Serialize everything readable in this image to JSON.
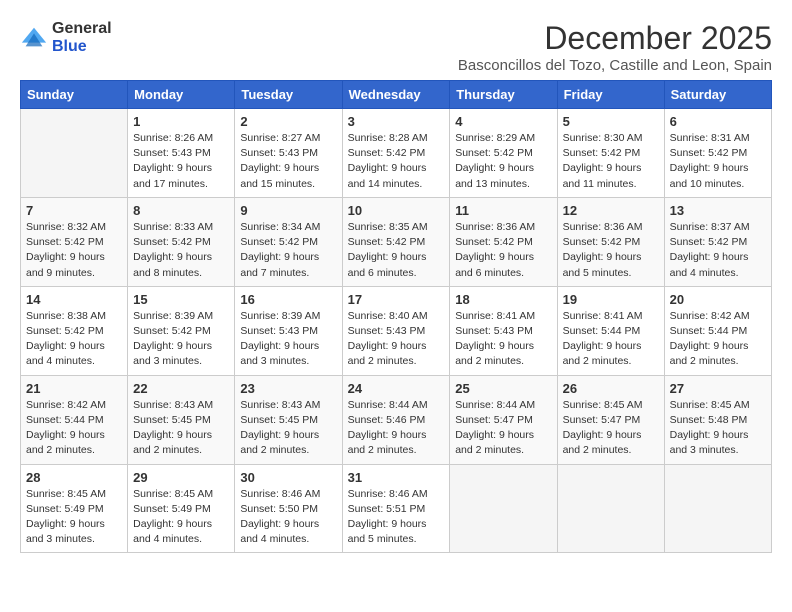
{
  "logo": {
    "general": "General",
    "blue": "Blue"
  },
  "title": "December 2025",
  "location": "Basconcillos del Tozo, Castille and Leon, Spain",
  "days_of_week": [
    "Sunday",
    "Monday",
    "Tuesday",
    "Wednesday",
    "Thursday",
    "Friday",
    "Saturday"
  ],
  "weeks": [
    [
      {
        "day": "",
        "empty": true
      },
      {
        "day": "1",
        "sunrise": "Sunrise: 8:26 AM",
        "sunset": "Sunset: 5:43 PM",
        "daylight": "Daylight: 9 hours and 17 minutes."
      },
      {
        "day": "2",
        "sunrise": "Sunrise: 8:27 AM",
        "sunset": "Sunset: 5:43 PM",
        "daylight": "Daylight: 9 hours and 15 minutes."
      },
      {
        "day": "3",
        "sunrise": "Sunrise: 8:28 AM",
        "sunset": "Sunset: 5:42 PM",
        "daylight": "Daylight: 9 hours and 14 minutes."
      },
      {
        "day": "4",
        "sunrise": "Sunrise: 8:29 AM",
        "sunset": "Sunset: 5:42 PM",
        "daylight": "Daylight: 9 hours and 13 minutes."
      },
      {
        "day": "5",
        "sunrise": "Sunrise: 8:30 AM",
        "sunset": "Sunset: 5:42 PM",
        "daylight": "Daylight: 9 hours and 11 minutes."
      },
      {
        "day": "6",
        "sunrise": "Sunrise: 8:31 AM",
        "sunset": "Sunset: 5:42 PM",
        "daylight": "Daylight: 9 hours and 10 minutes."
      }
    ],
    [
      {
        "day": "7",
        "sunrise": "Sunrise: 8:32 AM",
        "sunset": "Sunset: 5:42 PM",
        "daylight": "Daylight: 9 hours and 9 minutes."
      },
      {
        "day": "8",
        "sunrise": "Sunrise: 8:33 AM",
        "sunset": "Sunset: 5:42 PM",
        "daylight": "Daylight: 9 hours and 8 minutes."
      },
      {
        "day": "9",
        "sunrise": "Sunrise: 8:34 AM",
        "sunset": "Sunset: 5:42 PM",
        "daylight": "Daylight: 9 hours and 7 minutes."
      },
      {
        "day": "10",
        "sunrise": "Sunrise: 8:35 AM",
        "sunset": "Sunset: 5:42 PM",
        "daylight": "Daylight: 9 hours and 6 minutes."
      },
      {
        "day": "11",
        "sunrise": "Sunrise: 8:36 AM",
        "sunset": "Sunset: 5:42 PM",
        "daylight": "Daylight: 9 hours and 6 minutes."
      },
      {
        "day": "12",
        "sunrise": "Sunrise: 8:36 AM",
        "sunset": "Sunset: 5:42 PM",
        "daylight": "Daylight: 9 hours and 5 minutes."
      },
      {
        "day": "13",
        "sunrise": "Sunrise: 8:37 AM",
        "sunset": "Sunset: 5:42 PM",
        "daylight": "Daylight: 9 hours and 4 minutes."
      }
    ],
    [
      {
        "day": "14",
        "sunrise": "Sunrise: 8:38 AM",
        "sunset": "Sunset: 5:42 PM",
        "daylight": "Daylight: 9 hours and 4 minutes."
      },
      {
        "day": "15",
        "sunrise": "Sunrise: 8:39 AM",
        "sunset": "Sunset: 5:42 PM",
        "daylight": "Daylight: 9 hours and 3 minutes."
      },
      {
        "day": "16",
        "sunrise": "Sunrise: 8:39 AM",
        "sunset": "Sunset: 5:43 PM",
        "daylight": "Daylight: 9 hours and 3 minutes."
      },
      {
        "day": "17",
        "sunrise": "Sunrise: 8:40 AM",
        "sunset": "Sunset: 5:43 PM",
        "daylight": "Daylight: 9 hours and 2 minutes."
      },
      {
        "day": "18",
        "sunrise": "Sunrise: 8:41 AM",
        "sunset": "Sunset: 5:43 PM",
        "daylight": "Daylight: 9 hours and 2 minutes."
      },
      {
        "day": "19",
        "sunrise": "Sunrise: 8:41 AM",
        "sunset": "Sunset: 5:44 PM",
        "daylight": "Daylight: 9 hours and 2 minutes."
      },
      {
        "day": "20",
        "sunrise": "Sunrise: 8:42 AM",
        "sunset": "Sunset: 5:44 PM",
        "daylight": "Daylight: 9 hours and 2 minutes."
      }
    ],
    [
      {
        "day": "21",
        "sunrise": "Sunrise: 8:42 AM",
        "sunset": "Sunset: 5:44 PM",
        "daylight": "Daylight: 9 hours and 2 minutes."
      },
      {
        "day": "22",
        "sunrise": "Sunrise: 8:43 AM",
        "sunset": "Sunset: 5:45 PM",
        "daylight": "Daylight: 9 hours and 2 minutes."
      },
      {
        "day": "23",
        "sunrise": "Sunrise: 8:43 AM",
        "sunset": "Sunset: 5:45 PM",
        "daylight": "Daylight: 9 hours and 2 minutes."
      },
      {
        "day": "24",
        "sunrise": "Sunrise: 8:44 AM",
        "sunset": "Sunset: 5:46 PM",
        "daylight": "Daylight: 9 hours and 2 minutes."
      },
      {
        "day": "25",
        "sunrise": "Sunrise: 8:44 AM",
        "sunset": "Sunset: 5:47 PM",
        "daylight": "Daylight: 9 hours and 2 minutes."
      },
      {
        "day": "26",
        "sunrise": "Sunrise: 8:45 AM",
        "sunset": "Sunset: 5:47 PM",
        "daylight": "Daylight: 9 hours and 2 minutes."
      },
      {
        "day": "27",
        "sunrise": "Sunrise: 8:45 AM",
        "sunset": "Sunset: 5:48 PM",
        "daylight": "Daylight: 9 hours and 3 minutes."
      }
    ],
    [
      {
        "day": "28",
        "sunrise": "Sunrise: 8:45 AM",
        "sunset": "Sunset: 5:49 PM",
        "daylight": "Daylight: 9 hours and 3 minutes."
      },
      {
        "day": "29",
        "sunrise": "Sunrise: 8:45 AM",
        "sunset": "Sunset: 5:49 PM",
        "daylight": "Daylight: 9 hours and 4 minutes."
      },
      {
        "day": "30",
        "sunrise": "Sunrise: 8:46 AM",
        "sunset": "Sunset: 5:50 PM",
        "daylight": "Daylight: 9 hours and 4 minutes."
      },
      {
        "day": "31",
        "sunrise": "Sunrise: 8:46 AM",
        "sunset": "Sunset: 5:51 PM",
        "daylight": "Daylight: 9 hours and 5 minutes."
      },
      {
        "day": "",
        "empty": true
      },
      {
        "day": "",
        "empty": true
      },
      {
        "day": "",
        "empty": true
      }
    ]
  ]
}
